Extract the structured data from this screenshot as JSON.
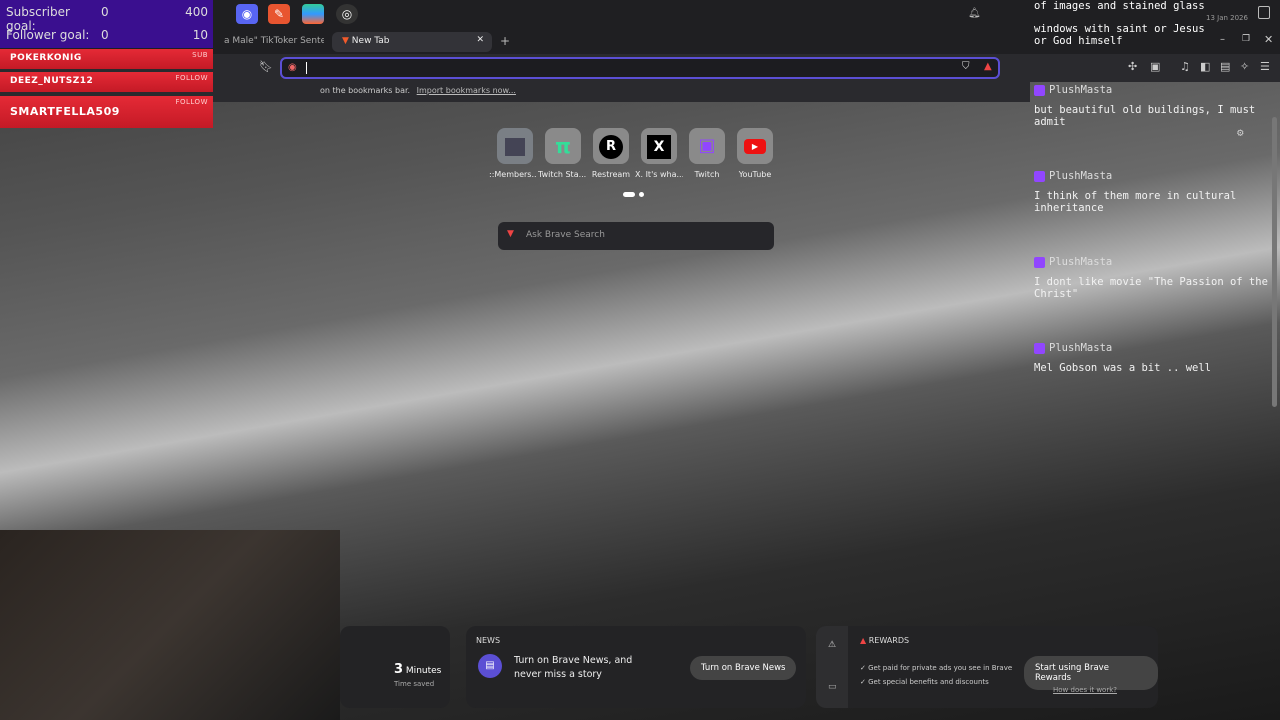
{
  "overlay": {
    "subscriber_goal_label": "Subscriber goal:",
    "subscriber_goal_current": "0",
    "subscriber_goal_target": "400",
    "follower_goal_label": "Follower goal:",
    "follower_goal_current": "0",
    "follower_goal_target": "10",
    "alerts": [
      {
        "name": "POKERKONIG",
        "kind": "SUB"
      },
      {
        "name": "DEEZ_NUTSZ12",
        "kind": "FOLLOW"
      },
      {
        "name": "SMARTFELLA509",
        "kind": "FOLLOW"
      }
    ]
  },
  "taskbar": {
    "date": "13 Jan 2026",
    "apps": [
      "discord-icon",
      "deal-tag-icon",
      "layers-icon",
      "obs-icon"
    ]
  },
  "browser": {
    "tabs": [
      {
        "title": "a Male\" TikToker Sentence"
      },
      {
        "title": "New Tab"
      }
    ],
    "url_value": "",
    "bookmarks_hint": "on the bookmarks bar.",
    "import_link": "Import bookmarks now..."
  },
  "newtab": {
    "top_sites": [
      {
        "label": "::Members..."
      },
      {
        "label": "Twitch Sta..."
      },
      {
        "label": "Restream",
        "glyph": "R"
      },
      {
        "label": "X. It's wha...",
        "glyph": "X"
      },
      {
        "label": "Twitch"
      },
      {
        "label": "YouTube"
      }
    ],
    "search_placeholder": "Ask Brave Search",
    "stats": {
      "value": "3",
      "unit": "Minutes",
      "caption": "Time saved"
    },
    "news": {
      "header": "NEWS",
      "text": "Turn on Brave News, and never miss a story",
      "button": "Turn on Brave News"
    },
    "rewards": {
      "header": "REWARDS",
      "bullets": [
        "Get paid for private ads you see in Brave",
        "Get special benefits and discounts"
      ],
      "button": "Start using Brave Rewards",
      "link": "How does it work?"
    }
  },
  "chat": {
    "top_lines": [
      "of images and stained glass",
      "windows with saint or Jesus",
      "or God himself"
    ],
    "messages": [
      {
        "user": "PlushMasta",
        "text": "but beautiful old buildings, I must admit"
      },
      {
        "user": "PlushMasta",
        "text": "I think of them more in cultural inheritance"
      },
      {
        "user": "PlushMasta",
        "text": "I dont like movie \"The Passion of the Christ\""
      },
      {
        "user": "PlushMasta",
        "text": "Mel Gobson was a bit .. well"
      }
    ]
  },
  "colors": {
    "goal_bg": "#3a0f8f",
    "alert_red": "#e52a36",
    "twitch": "#9146ff",
    "url_focus": "#5b4fd4"
  }
}
